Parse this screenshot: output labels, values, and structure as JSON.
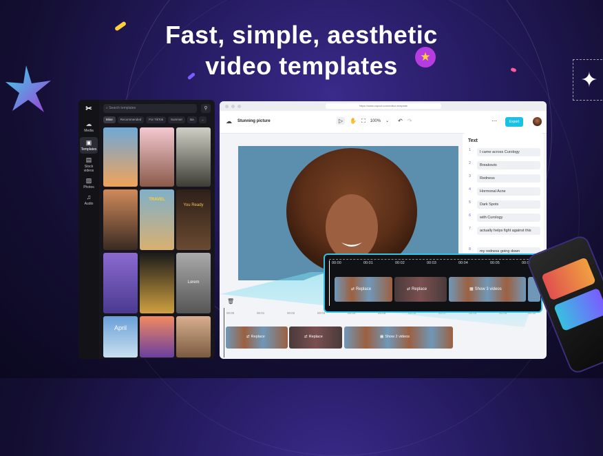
{
  "hero": {
    "line1": "Fast, simple, aesthetic",
    "line2": "video templates"
  },
  "sidebar": {
    "rail": [
      {
        "label": "Media",
        "icon": "cloud-upload-icon"
      },
      {
        "label": "Templates",
        "icon": "templates-icon"
      },
      {
        "label": "Stock videos",
        "icon": "film-icon"
      },
      {
        "label": "Photos",
        "icon": "image-icon"
      },
      {
        "label": "Audio",
        "icon": "music-icon"
      }
    ],
    "search_placeholder": "Search templates",
    "chips": [
      "Mine",
      "Recommended",
      "For TikTok",
      "Summer",
      "Ba"
    ],
    "tiles": [
      "April",
      "TRAVEL",
      "Lorem",
      "You Ready"
    ]
  },
  "editor": {
    "url": "https://www.capcut.com/editor-template",
    "project_name": "Stunning picture",
    "zoom": "100%",
    "export_label": "Export",
    "text_panel": {
      "title": "Text",
      "items": [
        {
          "n": "1",
          "text": "I came across Curology"
        },
        {
          "n": "2",
          "text": "Breakouts"
        },
        {
          "n": "3",
          "text": "Redness"
        },
        {
          "n": "4",
          "text": "Hormonal Acne"
        },
        {
          "n": "5",
          "text": "Dark Spots"
        },
        {
          "n": "6",
          "text": "with Curology"
        },
        {
          "n": "7",
          "text": "actually helps fight against this"
        },
        {
          "n": "8",
          "text": "my redness going down"
        }
      ]
    },
    "ruler": [
      "00:00",
      "00:01",
      "00:02",
      "00:03",
      "00:04",
      "00:05",
      "00:06",
      "00:07",
      "00:08",
      "00:09",
      "00:10"
    ],
    "clips": [
      {
        "label": "Replace"
      },
      {
        "label": "Replace"
      },
      {
        "label": "Show 2 videos"
      }
    ]
  },
  "zoom_panel": {
    "ruler": [
      "00:00",
      "00:01",
      "00:02",
      "00:03",
      "00:04",
      "00:05",
      "00:06"
    ],
    "clips": [
      {
        "label": "Replace"
      },
      {
        "label": "Replace"
      },
      {
        "label": "Show 3 videos"
      }
    ]
  }
}
